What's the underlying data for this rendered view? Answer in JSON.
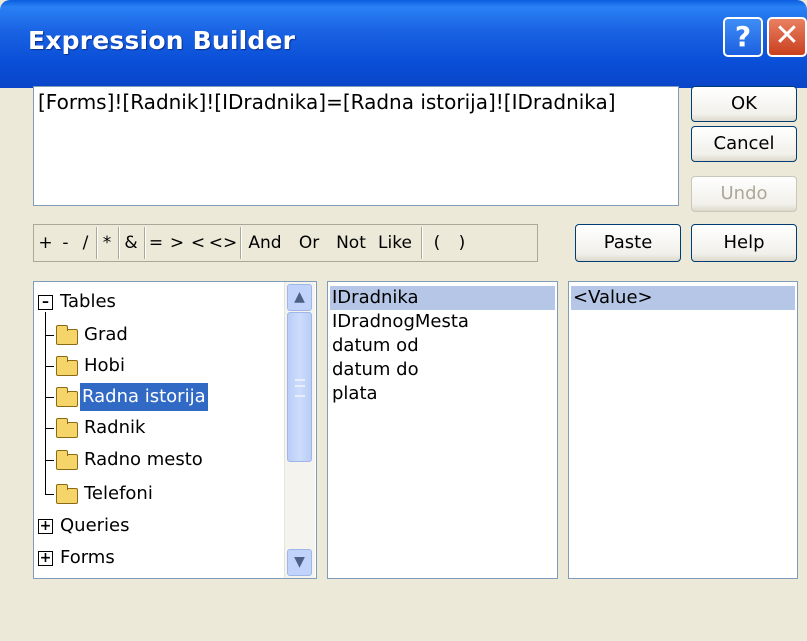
{
  "window": {
    "title": "Expression Builder",
    "help_glyph": "?",
    "close_glyph": "✕"
  },
  "expression": "[Forms]![Radnik]![IDradnika]=[Radna istorija]![IDradnika]",
  "buttons": {
    "ok": "OK",
    "cancel": "Cancel",
    "undo": "Undo",
    "paste": "Paste",
    "help": "Help"
  },
  "operators": [
    "+",
    "-",
    "/",
    "*",
    "&",
    "=",
    ">",
    "<",
    "<>",
    "And",
    "Or",
    "Not",
    "Like",
    "(",
    ")"
  ],
  "tree": {
    "items": [
      {
        "label": "Tables",
        "state": "expanded"
      },
      {
        "label": "Grad"
      },
      {
        "label": "Hobi"
      },
      {
        "label": "Radna istorija",
        "selected": true
      },
      {
        "label": "Radnik"
      },
      {
        "label": "Radno mesto"
      },
      {
        "label": "Telefoni"
      },
      {
        "label": "Queries",
        "state": "collapsed"
      },
      {
        "label": "Forms",
        "state": "collapsed"
      }
    ]
  },
  "fields": [
    "IDradnika",
    "IDradnogMesta",
    "datum od",
    "datum do",
    "plata"
  ],
  "values": [
    "<Value>"
  ],
  "colors": {
    "titlebar": "#0a4fd8",
    "selection": "#316AC5",
    "inactive_selection": "#b5c6e6",
    "dialog_bg": "#ECE9D8"
  }
}
